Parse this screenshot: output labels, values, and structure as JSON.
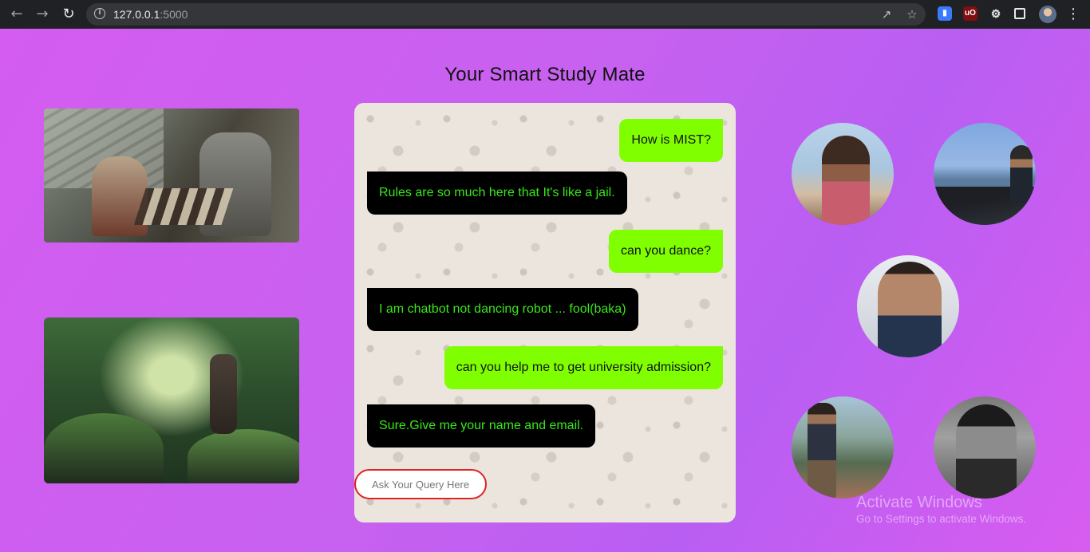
{
  "browser": {
    "url_host": "127.0.0.1",
    "url_port": ":5000",
    "icons": {
      "back": "arrow-left-icon",
      "forward": "arrow-right-icon",
      "reload": "reload-icon",
      "info": "info-icon",
      "share": "share-icon",
      "bookmark": "star-icon",
      "extensions": "puzzle-icon",
      "sidepanel": "side-panel-icon",
      "menu": "kebab-menu-icon"
    },
    "ext_ublock_label": "uO"
  },
  "page": {
    "title": "Your Smart Study Mate",
    "background_colors": [
      "#d45cf0",
      "#b95ef2"
    ]
  },
  "chat": {
    "messages": [
      {
        "sender": "user",
        "text": "How is MIST?"
      },
      {
        "sender": "bot",
        "text": "Rules are so much here that It's like a jail."
      },
      {
        "sender": "user",
        "text": "can you dance?"
      },
      {
        "sender": "bot",
        "text": "I am chatbot not dancing robot ... fool(baka)"
      },
      {
        "sender": "user",
        "text": "can you help me to get university admission?"
      },
      {
        "sender": "bot",
        "text": "Sure.Give me your name and email."
      }
    ],
    "input_placeholder": "Ask Your Query Here",
    "colors": {
      "user_bubble": "#80ff00",
      "bot_bubble": "#000000",
      "bot_text": "#39e81a",
      "input_border": "#e02222"
    }
  },
  "watermark": {
    "line1": "Activate Windows",
    "line2": "Go to Settings to activate Windows."
  }
}
